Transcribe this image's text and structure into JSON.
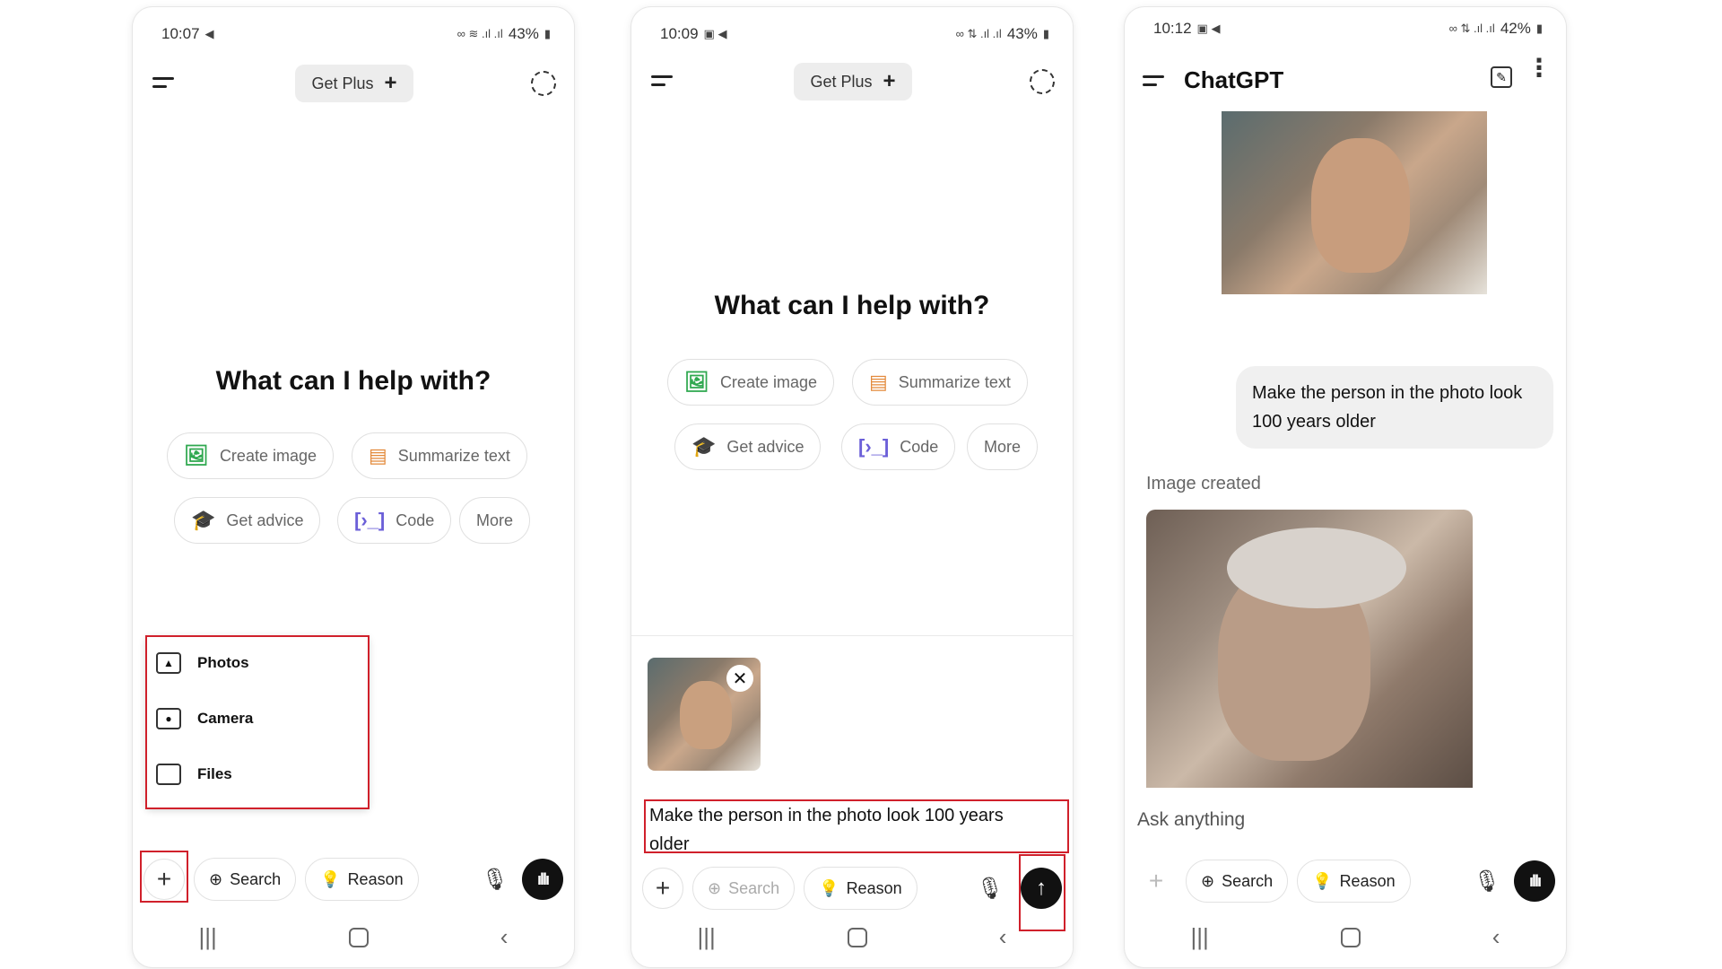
{
  "panel1": {
    "time": "10:07",
    "battery": "43%",
    "get_plus": "Get Plus",
    "headline": "What can I help with?",
    "chips": [
      "Create image",
      "Summarize text",
      "Get advice",
      "Code",
      "More"
    ],
    "menu": [
      "Photos",
      "Camera",
      "Files"
    ],
    "search": "Search",
    "reason": "Reason"
  },
  "panel2": {
    "time": "10:09",
    "battery": "43%",
    "get_plus": "Get Plus",
    "headline": "What can I help with?",
    "chips": [
      "Create image",
      "Summarize text",
      "Get advice",
      "Code",
      "More"
    ],
    "input_text_line1": "Make the person in the photo look 100 years",
    "input_text_line2": "older",
    "search": "Search",
    "reason": "Reason"
  },
  "panel3": {
    "time": "10:12",
    "battery": "42%",
    "app_title": "ChatGPT",
    "user_message": "Make the person in the photo look 100 years older",
    "image_created": "Image created",
    "input_placeholder": "Ask anything",
    "search": "Search",
    "reason": "Reason"
  },
  "colors": {
    "highlight": "#d0202b",
    "accent_dark": "#111111"
  }
}
